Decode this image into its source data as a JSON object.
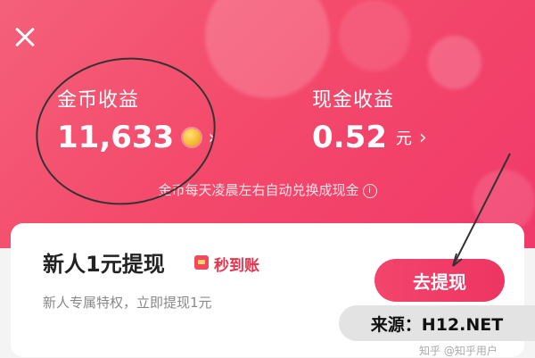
{
  "coins": {
    "label": "金币收益",
    "value": "11,633",
    "chevron": "›"
  },
  "cash": {
    "label": "现金收益",
    "value": "0.52",
    "unit": "元",
    "chevron": "›"
  },
  "note": {
    "text": "金币每天凌晨左右自动兑换成现金",
    "info_icon": "info-icon"
  },
  "card": {
    "title": "新人1元提现",
    "badge": "秒到账",
    "subtitle": "新人专属特权，立即提现1元",
    "button_label": "去提现"
  },
  "watermark": {
    "text": "来源：H12.NET",
    "faint_text": "知乎 @知乎用户"
  },
  "colors": {
    "hero_accent": "#f44a6b",
    "button": "#ef3864",
    "badge_text": "#e8334c"
  }
}
